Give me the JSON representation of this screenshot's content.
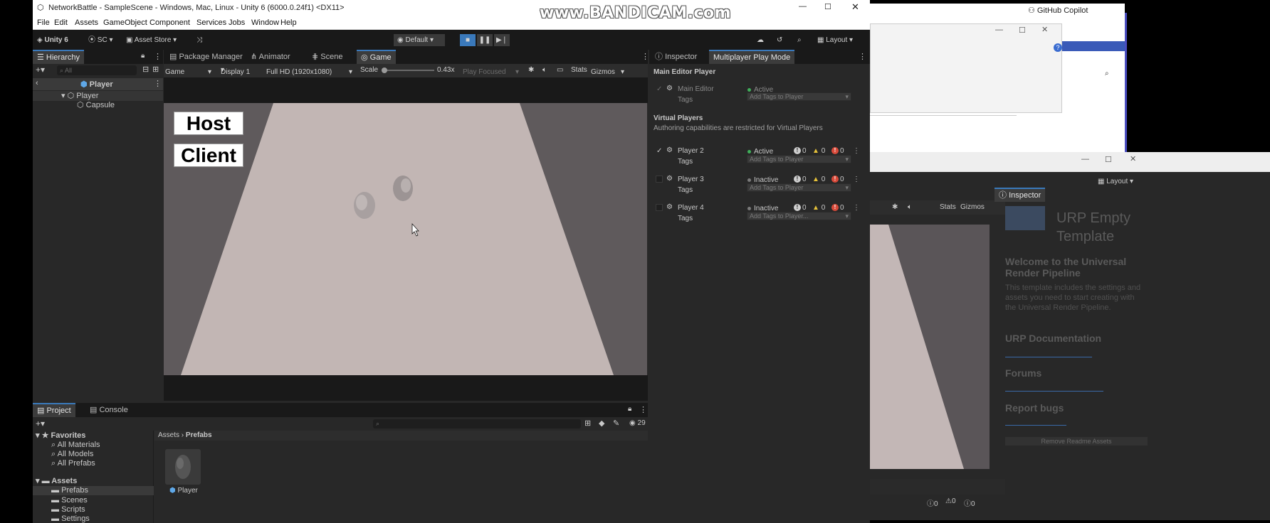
{
  "watermark": "www.BANDICAM.com",
  "window": {
    "title": "NetworkBattle - SampleScene - Windows, Mac, Linux - Unity 6 (6000.0.24f1) <DX11>"
  },
  "menu": [
    "File",
    "Edit",
    "Assets",
    "GameObject",
    "Component",
    "Services",
    "Jobs",
    "Window",
    "Help"
  ],
  "toolbar": {
    "unity_label": "Unity 6",
    "account": "SC",
    "asset_store": "Asset Store",
    "layout_default": "Default",
    "layout": "Layout"
  },
  "hierarchy": {
    "tab": "Hierarchy",
    "search_placeholder": "All",
    "context": "Player",
    "items": [
      "Player",
      "Capsule"
    ]
  },
  "center_tabs": [
    "Package Manager",
    "Animator",
    "Scene",
    "Game"
  ],
  "game_toolbar": {
    "mode": "Game",
    "display": "Display 1",
    "resolution": "Full HD (1920x1080)",
    "scale_label": "Scale",
    "scale_value": "0.43x",
    "play_focused": "Play Focused",
    "stats": "Stats",
    "gizmos": "Gizmos"
  },
  "game_ui": {
    "host": "Host",
    "client": "Client"
  },
  "right_tabs": [
    "Inspector",
    "Multiplayer Play Mode"
  ],
  "mppm": {
    "main_editor_header": "Main Editor Player",
    "main_editor_name": "Main Editor",
    "main_editor_status": "Active",
    "tags_label": "Tags",
    "tags_placeholder": "Add Tags to Player",
    "virtual_header": "Virtual Players",
    "virtual_note": "Authoring capabilities are restricted for Virtual Players",
    "players": [
      {
        "name": "Player 2",
        "status": "Active",
        "logs": "0",
        "warns": "0",
        "errors": "0",
        "tags": "Add Tags to Player"
      },
      {
        "name": "Player 3",
        "status": "Inactive",
        "logs": "0",
        "warns": "0",
        "errors": "0",
        "tags": "Add Tags to Player"
      },
      {
        "name": "Player 4",
        "status": "Inactive",
        "logs": "0",
        "warns": "0",
        "errors": "0",
        "tags": "Add Tags to Player..."
      }
    ]
  },
  "bottom": {
    "tabs": [
      "Project",
      "Console"
    ],
    "hidden_count": "29",
    "breadcrumb": [
      "Assets",
      "Prefabs"
    ],
    "favorites_label": "Favorites",
    "favorites": [
      "All Materials",
      "All Models",
      "All Prefabs"
    ],
    "assets_label": "Assets",
    "folders": [
      "Prefabs",
      "Scenes",
      "Scripts",
      "Settings"
    ],
    "asset_item": "Player"
  },
  "right_window": {
    "github_copilot": "GitHub Copilot",
    "inspector_tab": "Inspector",
    "layout": "Layout",
    "stats": "Stats",
    "gizmos": "Gizmos",
    "template_title": "URP Empty Template",
    "welcome": "Welcome to the Universal Render Pipeline",
    "description": "This template includes the settings and assets you need to start creating with the Universal Render Pipeline.",
    "sections": [
      "URP Documentation",
      "Forums",
      "Report bugs"
    ],
    "remove_button": "Remove Readme Assets",
    "console_counts": [
      "0",
      "0",
      "0"
    ]
  },
  "colors": {
    "accent_blue": "#3a79bb",
    "status_green": "#3fae5a",
    "warn_yellow": "#e6c23a",
    "error_red": "#d84a3a"
  }
}
